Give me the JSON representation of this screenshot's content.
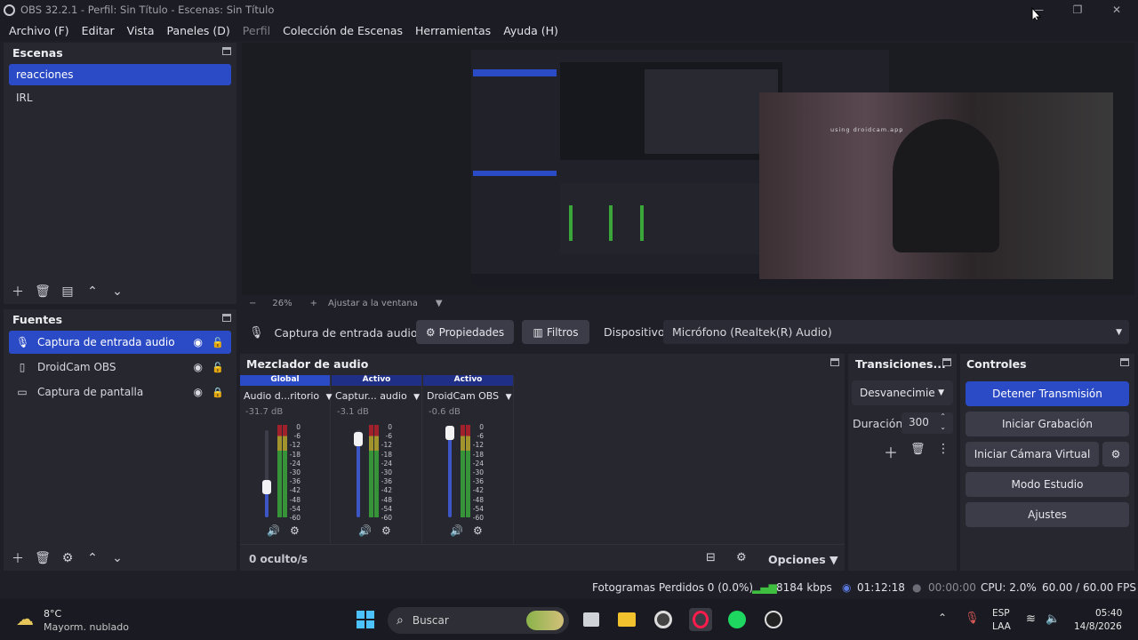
{
  "window": {
    "title": "OBS 32.2.1 - Perfil: Sin Título - Escenas: Sin Título",
    "minimize": "—",
    "maximize": "❐",
    "close": "✕"
  },
  "menu": {
    "items": [
      "Archivo (F)",
      "Editar",
      "Vista",
      "Paneles (D)",
      "Perfil",
      "Colección de Escenas",
      "Herramientas",
      "Ayuda (H)"
    ]
  },
  "scenes": {
    "title": "Escenas",
    "items": [
      "reacciones",
      "IRL"
    ],
    "selected": 0
  },
  "preview": {
    "zoom": "26%",
    "fit_label": "Ajustar a la ventana",
    "watermark": "using droidcam.app"
  },
  "sources": {
    "title": "Fuentes",
    "items": [
      {
        "name": "Captura de entrada audio",
        "icon": "microphone-icon"
      },
      {
        "name": "DroidCam OBS",
        "icon": "file-icon"
      },
      {
        "name": "Captura de pantalla",
        "icon": "monitor-icon"
      }
    ]
  },
  "properties_bar": {
    "source_name": "Captura de entrada audio",
    "properties": "Propiedades",
    "filters": "Filtros",
    "device_label": "Dispositivo",
    "device_value": "Micrófono (Realtek(R) Audio)"
  },
  "mixer": {
    "title": "Mezclador de audio",
    "channels": [
      {
        "tag": "Global",
        "tag_color": "#2b4ac5",
        "name": "Audio d...ritorio",
        "db": "-31.7 dB",
        "level": 0.35
      },
      {
        "tag": "Activo",
        "tag_color": "#1f2f86",
        "name": "Captur... audio",
        "db": "-3.1 dB",
        "level": 0.9
      },
      {
        "tag": "Activo",
        "tag_color": "#1f2f86",
        "name": "DroidCam OBS",
        "db": "-0.6 dB",
        "level": 0.97
      }
    ],
    "scale": [
      "0",
      "-6",
      "-12",
      "-18",
      "-24",
      "-30",
      "-36",
      "-42",
      "-48",
      "-54",
      "-60"
    ],
    "hidden_count": "0 oculto/s",
    "options": "Opciones"
  },
  "transitions": {
    "title": "Transiciones...",
    "selected": "Desvanecimie",
    "duration_label": "Duración",
    "duration_value": "300"
  },
  "controls": {
    "title": "Controles",
    "buttons": [
      "Detener Transmisión",
      "Iniciar Grabación",
      "Iniciar Cámara Virtual",
      "Modo Estudio",
      "Ajustes"
    ]
  },
  "status": {
    "dropped": "Fotogramas Perdidos 0 (0.0%)",
    "bitrate": "8184 kbps",
    "stream_time": "01:12:18",
    "rec_time": "00:00:00",
    "cpu": "CPU: 2.0%",
    "fps": "60.00 / 60.00 FPS"
  },
  "taskbar": {
    "weather_temp": "8°C",
    "weather_desc": "Mayorm. nublado",
    "search": "Buscar",
    "lang1": "ESP",
    "lang2": "LAA",
    "time": "05:40",
    "date": "14/8/2026"
  },
  "colors": {
    "accent": "#2b4ac5",
    "meter_green": "#3aa63a",
    "meter_yellow": "#b7a72c",
    "meter_red": "#b5202a"
  }
}
